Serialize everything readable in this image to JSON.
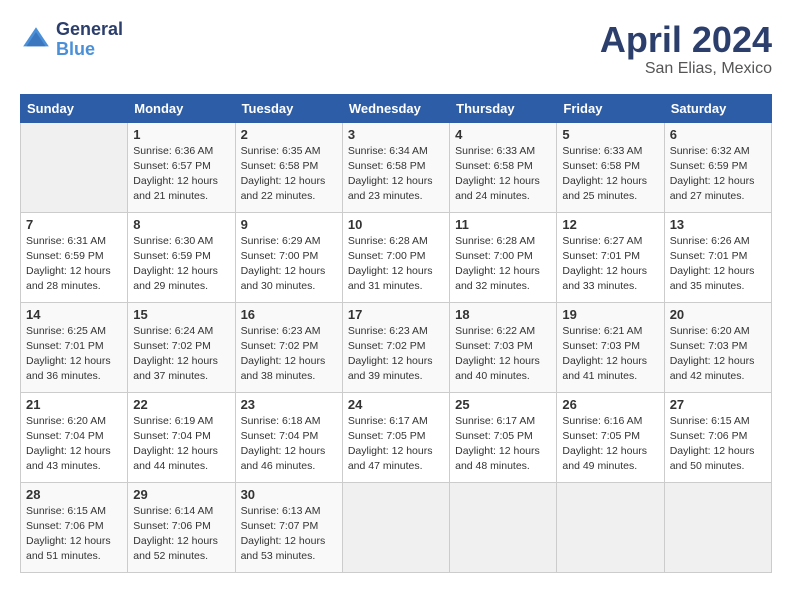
{
  "header": {
    "logo_line1": "General",
    "logo_line2": "Blue",
    "month": "April 2024",
    "location": "San Elias, Mexico"
  },
  "days_of_week": [
    "Sunday",
    "Monday",
    "Tuesday",
    "Wednesday",
    "Thursday",
    "Friday",
    "Saturday"
  ],
  "weeks": [
    [
      {
        "day": "",
        "sunrise": "",
        "sunset": "",
        "daylight": ""
      },
      {
        "day": "1",
        "sunrise": "Sunrise: 6:36 AM",
        "sunset": "Sunset: 6:57 PM",
        "daylight": "Daylight: 12 hours and 21 minutes."
      },
      {
        "day": "2",
        "sunrise": "Sunrise: 6:35 AM",
        "sunset": "Sunset: 6:58 PM",
        "daylight": "Daylight: 12 hours and 22 minutes."
      },
      {
        "day": "3",
        "sunrise": "Sunrise: 6:34 AM",
        "sunset": "Sunset: 6:58 PM",
        "daylight": "Daylight: 12 hours and 23 minutes."
      },
      {
        "day": "4",
        "sunrise": "Sunrise: 6:33 AM",
        "sunset": "Sunset: 6:58 PM",
        "daylight": "Daylight: 12 hours and 24 minutes."
      },
      {
        "day": "5",
        "sunrise": "Sunrise: 6:33 AM",
        "sunset": "Sunset: 6:58 PM",
        "daylight": "Daylight: 12 hours and 25 minutes."
      },
      {
        "day": "6",
        "sunrise": "Sunrise: 6:32 AM",
        "sunset": "Sunset: 6:59 PM",
        "daylight": "Daylight: 12 hours and 27 minutes."
      }
    ],
    [
      {
        "day": "7",
        "sunrise": "Sunrise: 6:31 AM",
        "sunset": "Sunset: 6:59 PM",
        "daylight": "Daylight: 12 hours and 28 minutes."
      },
      {
        "day": "8",
        "sunrise": "Sunrise: 6:30 AM",
        "sunset": "Sunset: 6:59 PM",
        "daylight": "Daylight: 12 hours and 29 minutes."
      },
      {
        "day": "9",
        "sunrise": "Sunrise: 6:29 AM",
        "sunset": "Sunset: 7:00 PM",
        "daylight": "Daylight: 12 hours and 30 minutes."
      },
      {
        "day": "10",
        "sunrise": "Sunrise: 6:28 AM",
        "sunset": "Sunset: 7:00 PM",
        "daylight": "Daylight: 12 hours and 31 minutes."
      },
      {
        "day": "11",
        "sunrise": "Sunrise: 6:28 AM",
        "sunset": "Sunset: 7:00 PM",
        "daylight": "Daylight: 12 hours and 32 minutes."
      },
      {
        "day": "12",
        "sunrise": "Sunrise: 6:27 AM",
        "sunset": "Sunset: 7:01 PM",
        "daylight": "Daylight: 12 hours and 33 minutes."
      },
      {
        "day": "13",
        "sunrise": "Sunrise: 6:26 AM",
        "sunset": "Sunset: 7:01 PM",
        "daylight": "Daylight: 12 hours and 35 minutes."
      }
    ],
    [
      {
        "day": "14",
        "sunrise": "Sunrise: 6:25 AM",
        "sunset": "Sunset: 7:01 PM",
        "daylight": "Daylight: 12 hours and 36 minutes."
      },
      {
        "day": "15",
        "sunrise": "Sunrise: 6:24 AM",
        "sunset": "Sunset: 7:02 PM",
        "daylight": "Daylight: 12 hours and 37 minutes."
      },
      {
        "day": "16",
        "sunrise": "Sunrise: 6:23 AM",
        "sunset": "Sunset: 7:02 PM",
        "daylight": "Daylight: 12 hours and 38 minutes."
      },
      {
        "day": "17",
        "sunrise": "Sunrise: 6:23 AM",
        "sunset": "Sunset: 7:02 PM",
        "daylight": "Daylight: 12 hours and 39 minutes."
      },
      {
        "day": "18",
        "sunrise": "Sunrise: 6:22 AM",
        "sunset": "Sunset: 7:03 PM",
        "daylight": "Daylight: 12 hours and 40 minutes."
      },
      {
        "day": "19",
        "sunrise": "Sunrise: 6:21 AM",
        "sunset": "Sunset: 7:03 PM",
        "daylight": "Daylight: 12 hours and 41 minutes."
      },
      {
        "day": "20",
        "sunrise": "Sunrise: 6:20 AM",
        "sunset": "Sunset: 7:03 PM",
        "daylight": "Daylight: 12 hours and 42 minutes."
      }
    ],
    [
      {
        "day": "21",
        "sunrise": "Sunrise: 6:20 AM",
        "sunset": "Sunset: 7:04 PM",
        "daylight": "Daylight: 12 hours and 43 minutes."
      },
      {
        "day": "22",
        "sunrise": "Sunrise: 6:19 AM",
        "sunset": "Sunset: 7:04 PM",
        "daylight": "Daylight: 12 hours and 44 minutes."
      },
      {
        "day": "23",
        "sunrise": "Sunrise: 6:18 AM",
        "sunset": "Sunset: 7:04 PM",
        "daylight": "Daylight: 12 hours and 46 minutes."
      },
      {
        "day": "24",
        "sunrise": "Sunrise: 6:17 AM",
        "sunset": "Sunset: 7:05 PM",
        "daylight": "Daylight: 12 hours and 47 minutes."
      },
      {
        "day": "25",
        "sunrise": "Sunrise: 6:17 AM",
        "sunset": "Sunset: 7:05 PM",
        "daylight": "Daylight: 12 hours and 48 minutes."
      },
      {
        "day": "26",
        "sunrise": "Sunrise: 6:16 AM",
        "sunset": "Sunset: 7:05 PM",
        "daylight": "Daylight: 12 hours and 49 minutes."
      },
      {
        "day": "27",
        "sunrise": "Sunrise: 6:15 AM",
        "sunset": "Sunset: 7:06 PM",
        "daylight": "Daylight: 12 hours and 50 minutes."
      }
    ],
    [
      {
        "day": "28",
        "sunrise": "Sunrise: 6:15 AM",
        "sunset": "Sunset: 7:06 PM",
        "daylight": "Daylight: 12 hours and 51 minutes."
      },
      {
        "day": "29",
        "sunrise": "Sunrise: 6:14 AM",
        "sunset": "Sunset: 7:06 PM",
        "daylight": "Daylight: 12 hours and 52 minutes."
      },
      {
        "day": "30",
        "sunrise": "Sunrise: 6:13 AM",
        "sunset": "Sunset: 7:07 PM",
        "daylight": "Daylight: 12 hours and 53 minutes."
      },
      {
        "day": "",
        "sunrise": "",
        "sunset": "",
        "daylight": ""
      },
      {
        "day": "",
        "sunrise": "",
        "sunset": "",
        "daylight": ""
      },
      {
        "day": "",
        "sunrise": "",
        "sunset": "",
        "daylight": ""
      },
      {
        "day": "",
        "sunrise": "",
        "sunset": "",
        "daylight": ""
      }
    ]
  ]
}
